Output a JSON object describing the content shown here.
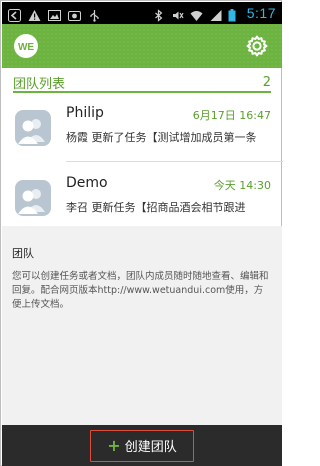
{
  "status_bar": {
    "time": "5:17",
    "icons": [
      "back-icon",
      "warning-icon",
      "image-icon",
      "camera-icon",
      "usb-icon",
      "bluetooth-icon",
      "mute-icon",
      "wifi-icon",
      "signal-icon",
      "battery-icon"
    ]
  },
  "header": {
    "logo_text": "WE",
    "settings_icon": "gear-icon"
  },
  "team_list": {
    "title": "团队列表",
    "count": "2",
    "items": [
      {
        "name": "Philip",
        "time": "6月17日 16:47",
        "message": "杨霞 更新了任务【测试增加成员第一条"
      },
      {
        "name": "Demo",
        "time": "今天 14:30",
        "message": "李召 更新任务【招商品酒会相节跟进"
      }
    ]
  },
  "info": {
    "title": "团队",
    "body": "您可以创建任务或者文档，团队内成员随时随地查看、编辑和回复。配合网页版本http://www.wetuandui.com使用，方便上传文档。"
  },
  "bottom": {
    "create_label": "创建团队"
  },
  "colors": {
    "accent": "#6db33f",
    "time_blue": "#33b5e5",
    "button_border": "#e04b3a"
  }
}
